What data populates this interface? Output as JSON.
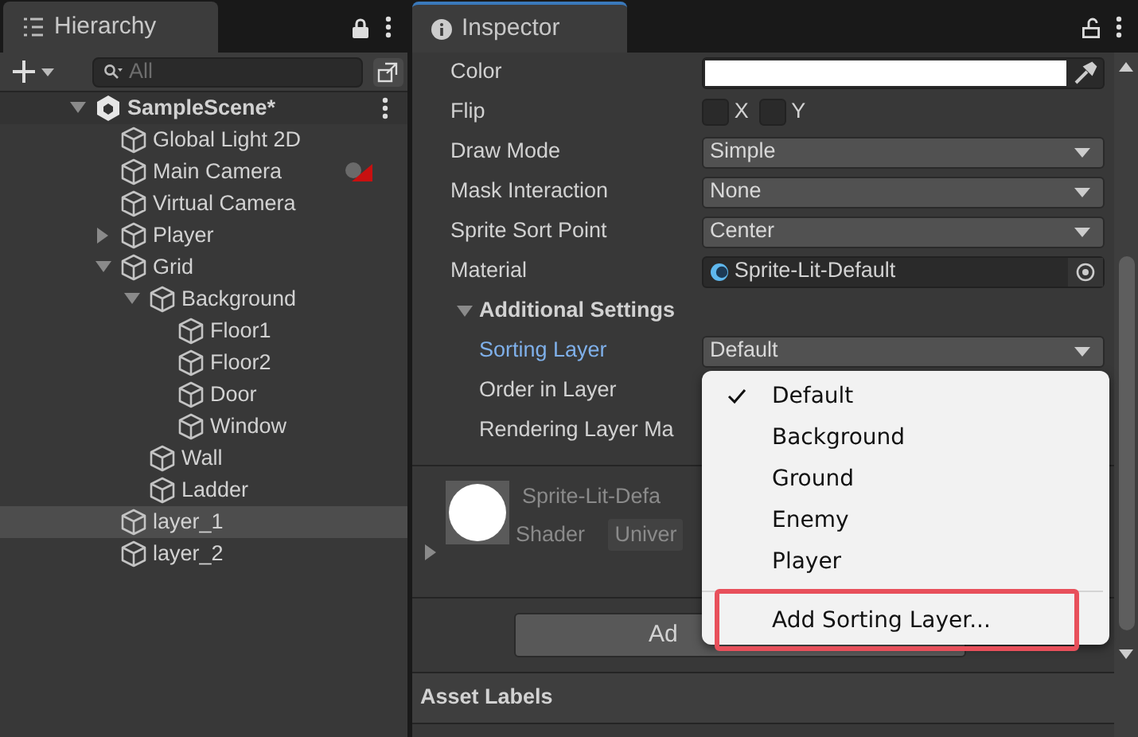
{
  "hierarchy": {
    "title": "Hierarchy",
    "search": {
      "placeholder": "All"
    },
    "scene": {
      "name": "SampleScene*",
      "expanded": true,
      "children": [
        {
          "name": "Global Light 2D",
          "selected": false
        },
        {
          "name": "Main Camera",
          "selected": false,
          "marked": true
        },
        {
          "name": "Virtual Camera",
          "selected": false
        },
        {
          "name": "Player",
          "selected": false,
          "expanded": false
        },
        {
          "name": "Grid",
          "selected": false,
          "expanded": true,
          "children": [
            {
              "name": "Background",
              "selected": false,
              "expanded": true,
              "children": [
                {
                  "name": "Floor1",
                  "selected": false
                },
                {
                  "name": "Floor2",
                  "selected": false
                },
                {
                  "name": "Door",
                  "selected": false
                },
                {
                  "name": "Window",
                  "selected": false
                }
              ]
            },
            {
              "name": "Wall",
              "selected": false
            },
            {
              "name": "Ladder",
              "selected": false
            }
          ]
        },
        {
          "name": "layer_1",
          "selected": true
        },
        {
          "name": "layer_2",
          "selected": false
        }
      ]
    }
  },
  "inspector": {
    "title": "Inspector",
    "fields": [
      {
        "kind": "color",
        "label": "Color"
      },
      {
        "kind": "flip",
        "label": "Flip",
        "options": [
          {
            "label": "X",
            "checked": false
          },
          {
            "label": "Y",
            "checked": false
          }
        ]
      },
      {
        "kind": "dropdown",
        "label": "Draw Mode",
        "value": "Simple"
      },
      {
        "kind": "dropdown",
        "label": "Mask Interaction",
        "value": "None"
      },
      {
        "kind": "dropdown",
        "label": "Sprite Sort Point",
        "value": "Center"
      },
      {
        "kind": "object",
        "label": "Material",
        "value": "Sprite-Lit-Default"
      },
      {
        "kind": "section",
        "label": "Additional Settings",
        "expanded": true,
        "children": [
          {
            "kind": "dropdown",
            "label": "Sorting Layer",
            "value": "Default",
            "active": true
          },
          {
            "kind": "label",
            "label": "Order in Layer",
            "active": false
          },
          {
            "kind": "label",
            "label": "Rendering Layer Ma",
            "active": false
          }
        ]
      }
    ],
    "material_preview": {
      "name": "Sprite-Lit-Defa",
      "shader_label": "Shader",
      "shader_value": "Univer",
      "expanded": false
    },
    "add_button": "Ad",
    "asset_labels": "Asset Labels"
  },
  "menu": {
    "items": [
      {
        "label": "Default",
        "selected": true
      },
      {
        "label": "Background",
        "selected": false
      },
      {
        "label": "Ground",
        "selected": false
      },
      {
        "label": "Enemy",
        "selected": false
      },
      {
        "label": "Player",
        "selected": false
      }
    ],
    "action": {
      "label": "Add Sorting Layer...",
      "highlighted": true
    }
  }
}
